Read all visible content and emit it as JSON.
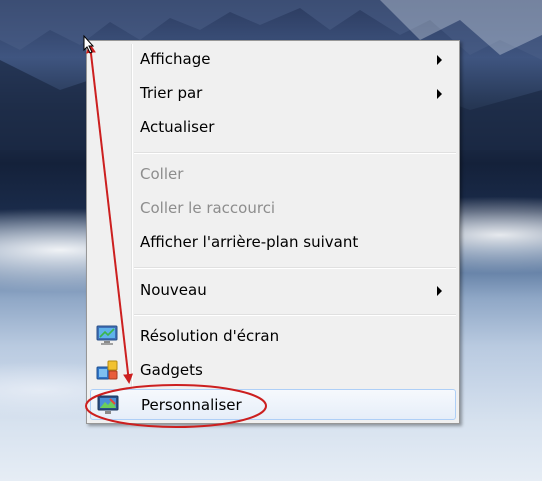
{
  "context_menu": {
    "items": [
      {
        "label": "Affichage",
        "submenu": true,
        "enabled": true
      },
      {
        "label": "Trier par",
        "submenu": true,
        "enabled": true
      },
      {
        "label": "Actualiser",
        "submenu": false,
        "enabled": true
      },
      {
        "label": "Coller",
        "submenu": false,
        "enabled": false
      },
      {
        "label": "Coller le raccourci",
        "submenu": false,
        "enabled": false
      },
      {
        "label": "Afficher l'arrière-plan suivant",
        "submenu": false,
        "enabled": true
      },
      {
        "label": "Nouveau",
        "submenu": true,
        "enabled": true
      },
      {
        "label": "Résolution d'écran",
        "submenu": false,
        "enabled": true,
        "icon": "display-icon"
      },
      {
        "label": "Gadgets",
        "submenu": false,
        "enabled": true,
        "icon": "gadgets-icon"
      },
      {
        "label": "Personnaliser",
        "submenu": false,
        "enabled": true,
        "icon": "personalize-icon",
        "highlighted": true
      }
    ]
  },
  "annotation": {
    "arrow_color": "#cc1f1f",
    "highlight_target": "Personnaliser"
  }
}
